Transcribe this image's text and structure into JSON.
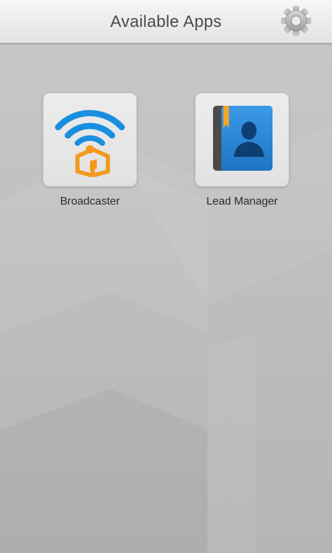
{
  "header": {
    "title": "Available Apps"
  },
  "apps": [
    {
      "label": "Broadcaster",
      "icon": "broadcaster-icon"
    },
    {
      "label": "Lead Manager",
      "icon": "contact-book-icon"
    }
  ],
  "colors": {
    "header_text": "#4a4a4a",
    "wifi_blue": "#1a8fe0",
    "house_orange": "#f39a1e",
    "book_blue": "#2a87d8",
    "book_spine": "#4a4a4a",
    "bookmark_orange": "#f5a623",
    "background": "#c2c2c2"
  }
}
